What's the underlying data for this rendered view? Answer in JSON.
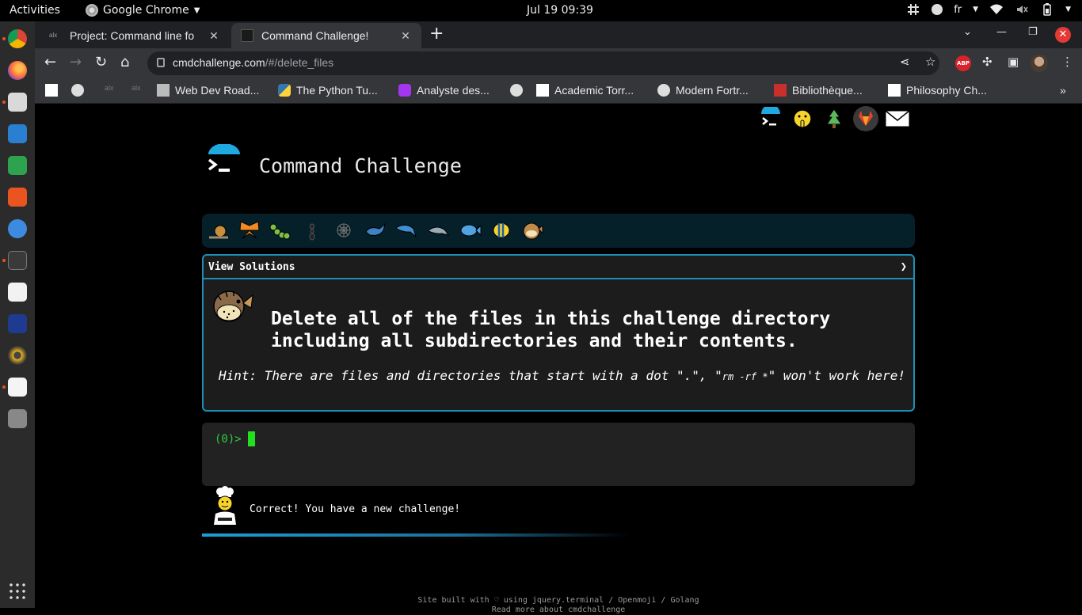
{
  "system": {
    "activities": "Activities",
    "app_name": "Google Chrome",
    "clock": "Jul 19  09:39",
    "keyboard_layout": "fr"
  },
  "browser": {
    "tabs": [
      {
        "title": "Project: Command line fo",
        "active": false
      },
      {
        "title": "Command Challenge!",
        "active": true
      }
    ],
    "url_host": "cmdchallenge.com",
    "url_path": "/#/delete_files",
    "extension_abp": "ABP",
    "bookmarks": [
      {
        "label": "Web Dev Road..."
      },
      {
        "label": "The Python Tu..."
      },
      {
        "label": "Analyste des..."
      },
      {
        "label": "Academic Torr..."
      },
      {
        "label": "Modern Fortr..."
      },
      {
        "label": "Bibliothèque..."
      },
      {
        "label": "Philosophy Ch..."
      }
    ]
  },
  "page": {
    "site_title": "Command Challenge",
    "view_solutions": "View Solutions",
    "solutions_arrow": "❯",
    "challenge_line1": "Delete all of the files in this challenge directory",
    "challenge_line2": "including all subdirectories and their contents.",
    "hint_prefix": "Hint: There are files and directories that start with a dot \".\", \"",
    "hint_cmd": "rm -rf *",
    "hint_suffix": "\" won't work here!",
    "prompt": "(0)> ",
    "feedback": "Correct! You have a new challenge!",
    "footer_line1": "Site built with ♡ using jquery.terminal / Openmoji / Golang",
    "footer_line2": "Read more about cmdchallenge"
  },
  "colors": {
    "accent_blue": "#1d8fb7",
    "terminal_green": "#2ecc40",
    "level_bar_bg": "#06202a"
  }
}
